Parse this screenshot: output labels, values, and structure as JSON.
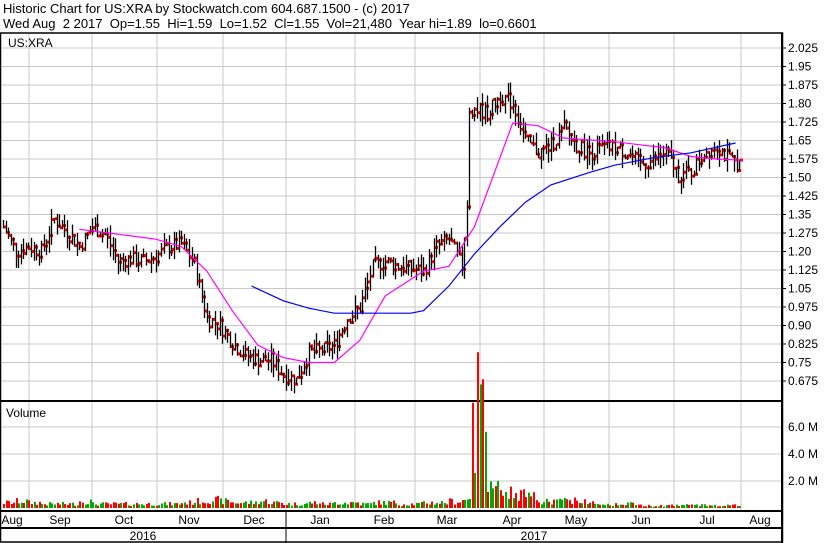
{
  "header": {
    "line1": "Historic Chart for US:XRA by Stockwatch.com 604.687.1500 - (c) 2017",
    "line2": "Wed Aug  2 2017  Op=1.55  Hi=1.59  Lo=1.52  Cl=1.55  Vol=21,480  Year hi=1.89  lo=0.6601"
  },
  "chart_data": [
    {
      "type": "line",
      "title": "US:XRA",
      "description_series": "weekly approximate closes, OHLC bars",
      "y_ticks": [
        "2.025",
        "1.95",
        "1.875",
        "1.80",
        "1.725",
        "1.65",
        "1.575",
        "1.50",
        "1.425",
        "1.35",
        "1.275",
        "1.20",
        "1.125",
        "1.05",
        "0.975",
        "0.90",
        "0.825",
        "0.75",
        "0.675"
      ],
      "ylim": [
        0.675,
        2.025
      ],
      "closes": [
        1.3,
        1.2,
        1.22,
        1.2,
        1.33,
        1.28,
        1.22,
        1.3,
        1.27,
        1.16,
        1.17,
        1.16,
        1.18,
        1.22,
        1.23,
        1.15,
        0.93,
        0.9,
        0.83,
        0.78,
        0.76,
        0.76,
        0.7,
        0.68,
        0.79,
        0.8,
        0.82,
        0.93,
        0.97,
        1.14,
        1.16,
        1.14,
        1.13,
        1.12,
        1.22,
        1.25,
        1.14,
        1.78,
        1.76,
        1.83,
        1.8,
        1.65,
        1.6,
        1.63,
        1.7,
        1.63,
        1.6,
        1.62,
        1.62,
        1.6,
        1.55,
        1.57,
        1.6,
        1.51,
        1.52,
        1.6,
        1.63,
        1.57,
        1.55
      ],
      "ma_short": {
        "color": "#ff00ff",
        "points": [
          [
            6,
            1.29
          ],
          [
            9,
            1.27
          ],
          [
            12,
            1.25
          ],
          [
            14,
            1.22
          ],
          [
            16,
            1.12
          ],
          [
            18,
            0.96
          ],
          [
            20,
            0.82
          ],
          [
            22,
            0.77
          ],
          [
            24,
            0.75
          ],
          [
            26,
            0.75
          ],
          [
            28,
            0.84
          ],
          [
            30,
            1.02
          ],
          [
            33,
            1.12
          ],
          [
            35,
            1.14
          ],
          [
            37,
            1.3
          ],
          [
            39,
            1.58
          ],
          [
            40,
            1.72
          ],
          [
            42,
            1.71
          ],
          [
            44,
            1.66
          ],
          [
            48,
            1.645
          ],
          [
            52,
            1.62
          ],
          [
            54,
            1.585
          ],
          [
            56,
            1.575
          ],
          [
            58,
            1.57
          ]
        ]
      },
      "ma_long": {
        "color": "#0000ff",
        "points": [
          [
            19.5,
            1.06
          ],
          [
            22,
            1.0
          ],
          [
            24,
            0.97
          ],
          [
            26,
            0.95
          ],
          [
            29,
            0.95
          ],
          [
            32,
            0.95
          ],
          [
            33,
            0.96
          ],
          [
            35,
            1.06
          ],
          [
            37,
            1.19
          ],
          [
            39,
            1.3
          ],
          [
            41,
            1.4
          ],
          [
            43,
            1.47
          ],
          [
            46,
            1.52
          ],
          [
            48,
            1.55
          ],
          [
            51,
            1.58
          ],
          [
            54,
            1.6
          ],
          [
            57.5,
            1.64
          ]
        ]
      },
      "months": [
        "Aug",
        "Sep",
        "Oct",
        "Nov",
        "Dec",
        "Jan",
        "Feb",
        "Mar",
        "Apr",
        "May",
        "Jun",
        "Jul",
        "Aug"
      ],
      "years": [
        "2016",
        "2017"
      ],
      "up_color": "#00aa00",
      "down_color": "#ff0000"
    },
    {
      "type": "bar",
      "title": "Volume",
      "y_ticks": [
        "6.0 M",
        "4.0 M",
        "2.0 M"
      ],
      "ylim": [
        0,
        8
      ],
      "weekly_volume_millions": [
        0.4,
        0.5,
        0.4,
        0.3,
        0.3,
        0.3,
        0.5,
        0.3,
        0.3,
        0.3,
        0.3,
        0.3,
        0.3,
        0.3,
        0.4,
        0.5,
        0.6,
        0.5,
        0.4,
        0.4,
        0.5,
        0.4,
        0.3,
        0.3,
        0.4,
        0.3,
        0.4,
        0.4,
        0.3,
        0.4,
        0.4,
        0.3,
        0.3,
        0.4,
        0.4,
        0.5,
        0.6,
        7.8,
        1.4,
        1.2,
        1.0,
        0.8,
        0.5,
        0.5,
        0.6,
        0.5,
        0.4,
        0.3,
        0.3,
        0.3,
        0.2,
        0.2,
        0.2,
        0.2,
        0.2,
        0.2,
        0.2,
        0.2,
        0.2
      ]
    }
  ]
}
